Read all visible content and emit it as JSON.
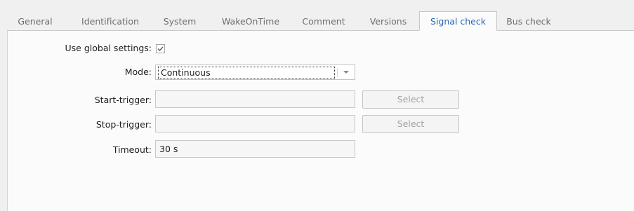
{
  "tabs": [
    {
      "label": "General"
    },
    {
      "label": "Identification"
    },
    {
      "label": "System"
    },
    {
      "label": "WakeOnTime"
    },
    {
      "label": "Comment"
    },
    {
      "label": "Versions"
    },
    {
      "label": "Signal check"
    },
    {
      "label": "Bus check"
    }
  ],
  "active_tab": "Signal check",
  "form": {
    "use_global_label": "Use global settings:",
    "use_global_checked": true,
    "mode_label": "Mode:",
    "mode_value": "Continuous",
    "start_trigger_label": "Start-trigger:",
    "start_trigger_value": "",
    "start_select_label": "Select",
    "stop_trigger_label": "Stop-trigger:",
    "stop_trigger_value": "",
    "stop_select_label": "Select",
    "timeout_label": "Timeout:",
    "timeout_value": "30 s"
  },
  "icons": {
    "checkbox": "check-mark-icon",
    "dropdown": "chevron-down-icon"
  },
  "colors": {
    "active_tab_text": "#2a66b8",
    "inactive_tab_text": "#6d6d6d",
    "disabled_button_text": "#a3a3a3"
  }
}
